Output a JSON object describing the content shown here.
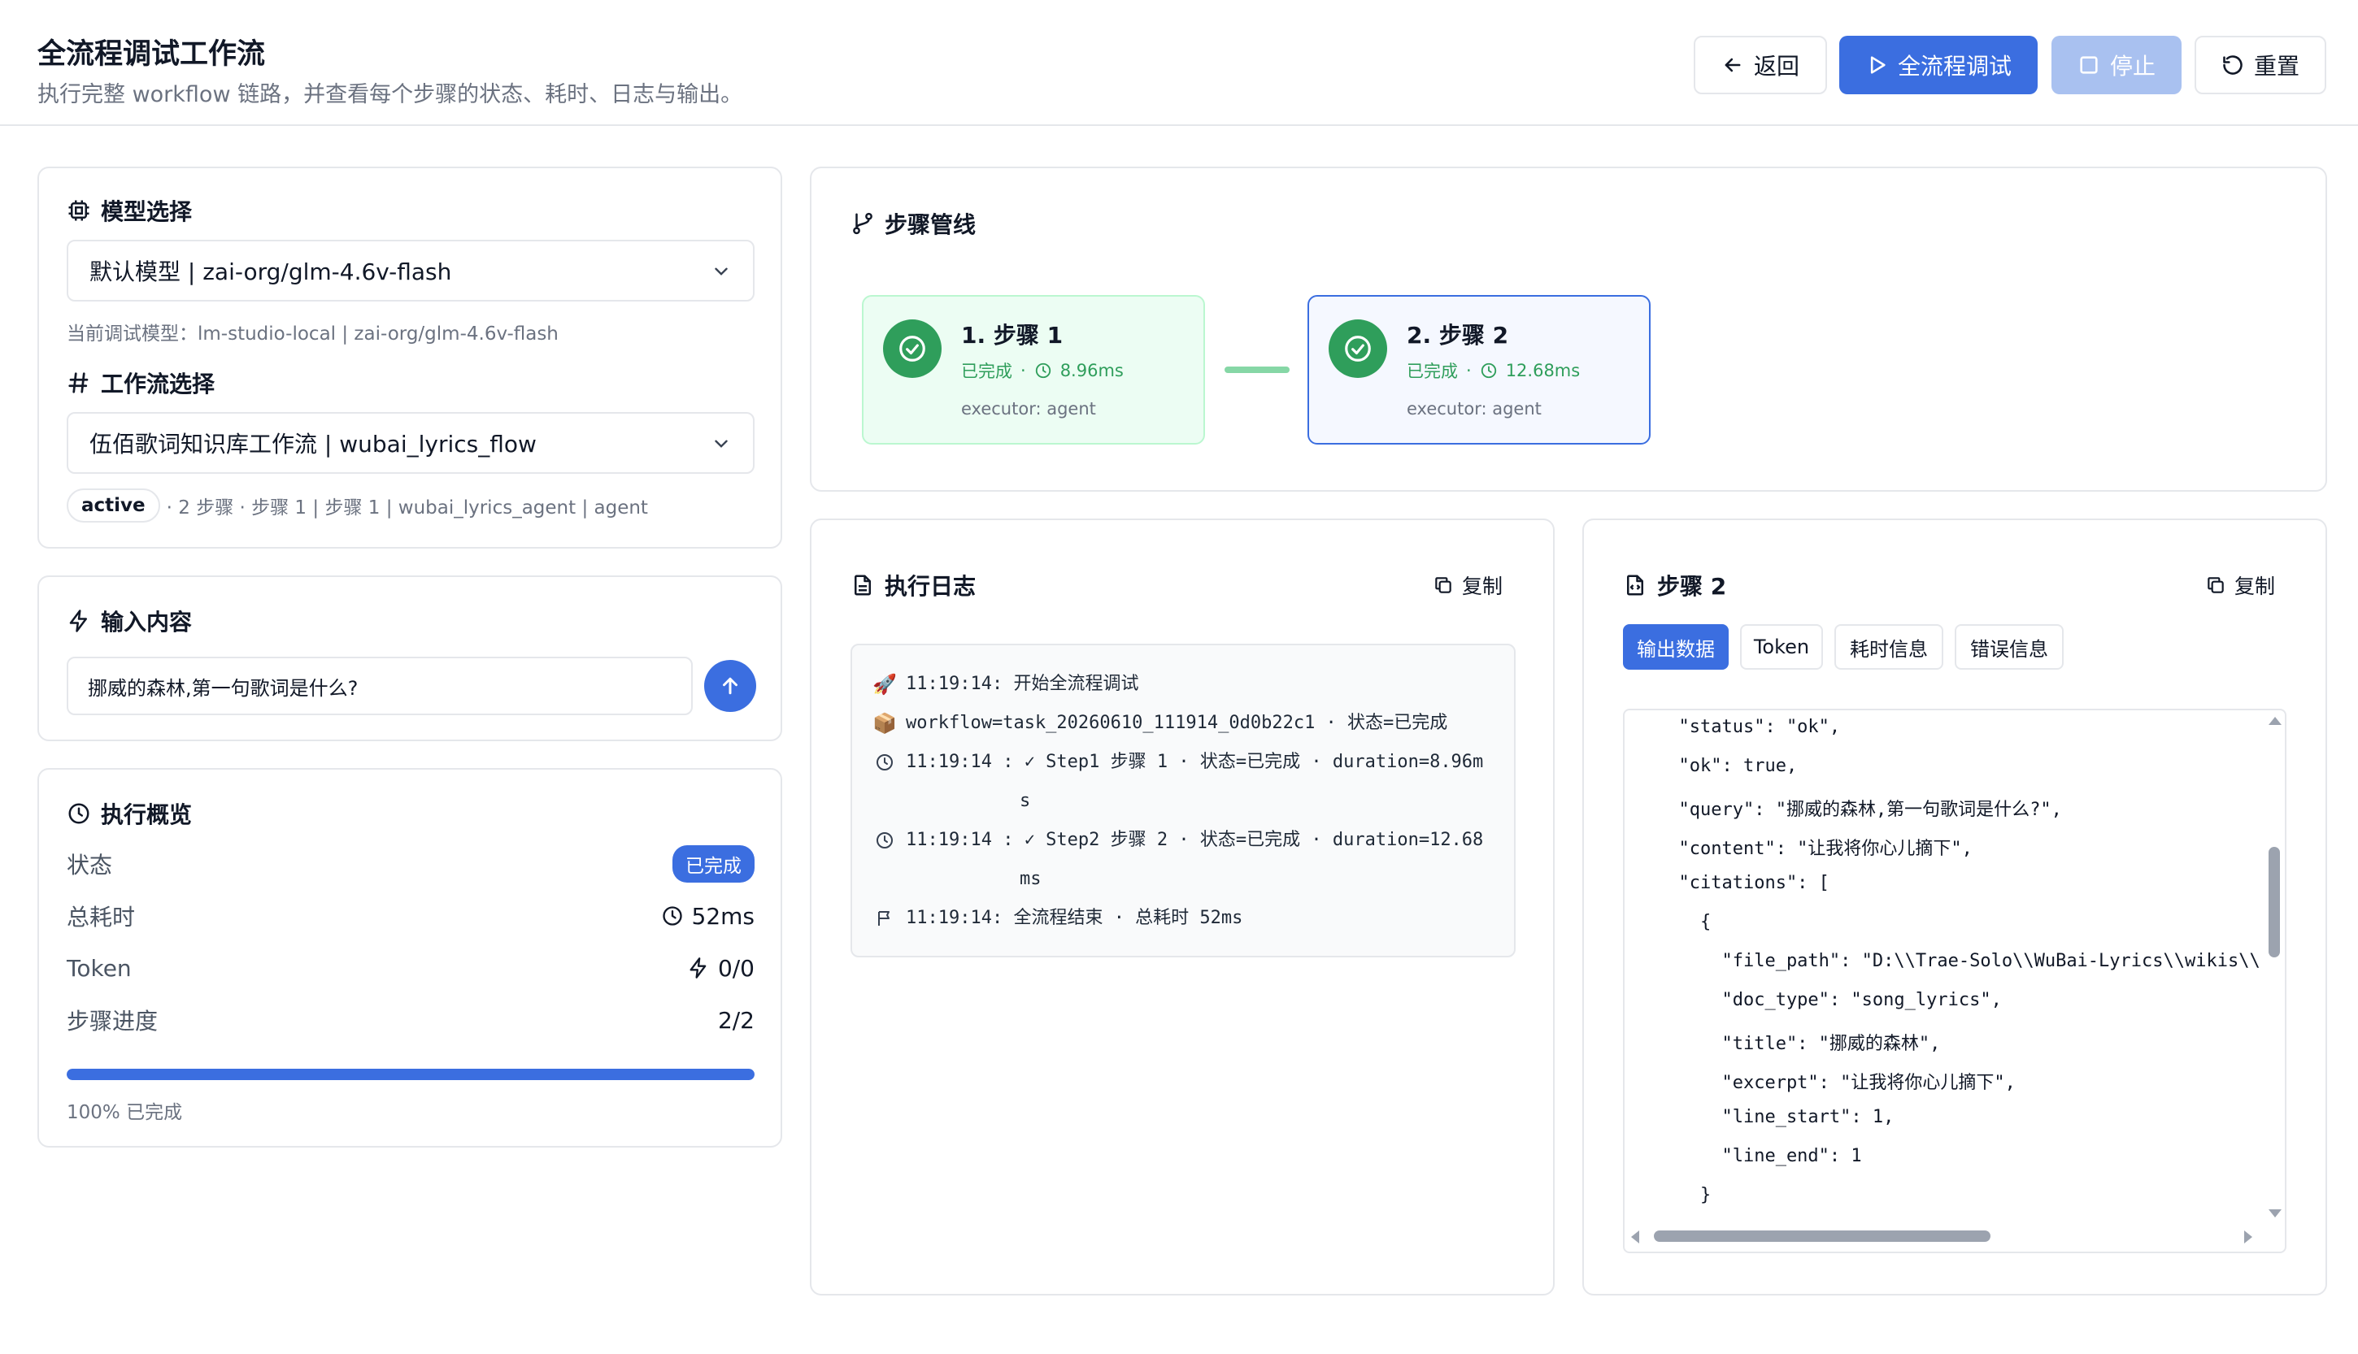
{
  "header": {
    "title": "全流程调试工作流",
    "subtitle": "执行完整 workflow 链路，并查看每个步骤的状态、耗时、日志与输出。",
    "back_label": "返回",
    "run_label": "全流程调试",
    "stop_label": "停止",
    "reset_label": "重置"
  },
  "config": {
    "model_title": "模型选择",
    "model_value": "默认模型 | zai-org/glm-4.6v-flash",
    "model_hint": "当前调试模型：lm-studio-local | zai-org/glm-4.6v-flash",
    "workflow_title": "工作流选择",
    "workflow_value": "伍佰歌词知识库工作流 | wubai_lyrics_flow",
    "workflow_status": "active",
    "workflow_hint": "· 2 步骤 · 步骤 1 | 步骤 1 | wubai_lyrics_agent | agent"
  },
  "input": {
    "title": "输入内容",
    "value": "挪威的森林,第一句歌词是什么?"
  },
  "overview": {
    "title": "执行概览",
    "status_label": "状态",
    "status_value": "已完成",
    "time_label": "总耗时",
    "time_value": "52ms",
    "token_label": "Token",
    "token_value": "0/0",
    "progress_label": "步骤进度",
    "progress_value": "2/2",
    "progress_fraction": 1.0,
    "progress_text": "100% 已完成"
  },
  "pipeline": {
    "title": "步骤管线",
    "steps": [
      {
        "name": "1. 步骤 1",
        "status": "已完成",
        "duration": "8.96ms",
        "executor": "executor: agent"
      },
      {
        "name": "2. 步骤 2",
        "status": "已完成",
        "duration": "12.68ms",
        "executor": "executor: agent"
      }
    ]
  },
  "log": {
    "title": "执行日志",
    "copy_label": "复制",
    "lines": [
      {
        "icon": "rocket-icon",
        "text": "11:19:14: 开始全流程调试"
      },
      {
        "icon": "package-icon",
        "text": "workflow=task_20260610_111914_0d0b22c1 · 状态=已完成"
      },
      {
        "icon": "clock-icon",
        "text": "11:19:14 : ✓ Step1 步骤 1 · 状态=已完成 · duration=8.96m"
      },
      {
        "icon": "",
        "text": "s"
      },
      {
        "icon": "clock-icon",
        "text": "11:19:14 : ✓ Step2 步骤 2 · 状态=已完成 · duration=12.68"
      },
      {
        "icon": "",
        "text": "ms"
      },
      {
        "icon": "flag-icon",
        "text": "11:19:14: 全流程结束 · 总耗时 52ms"
      }
    ]
  },
  "detail": {
    "title": "步骤 2",
    "copy_label": "复制",
    "tabs": [
      "输出数据",
      "Token",
      "耗时信息",
      "错误信息"
    ],
    "json_lines": [
      "  \"status\": \"ok\",",
      "  \"ok\": true,",
      "  \"query\": \"挪威的森林,第一句歌词是什么?\",",
      "  \"content\": \"让我将你心儿摘下\",",
      "  \"citations\": [",
      "    {",
      "      \"file_path\": \"D:\\\\Trae-Solo\\\\WuBai-Lyrics\\\\wikis\\\\",
      "      \"doc_type\": \"song_lyrics\",",
      "      \"title\": \"挪威的森林\",",
      "      \"excerpt\": \"让我将你心儿摘下\",",
      "      \"line_start\": 1,",
      "      \"line_end\": 1",
      "    }"
    ]
  },
  "colors": {
    "accent": "#3b6ee0",
    "success": "#2f9e5b"
  }
}
